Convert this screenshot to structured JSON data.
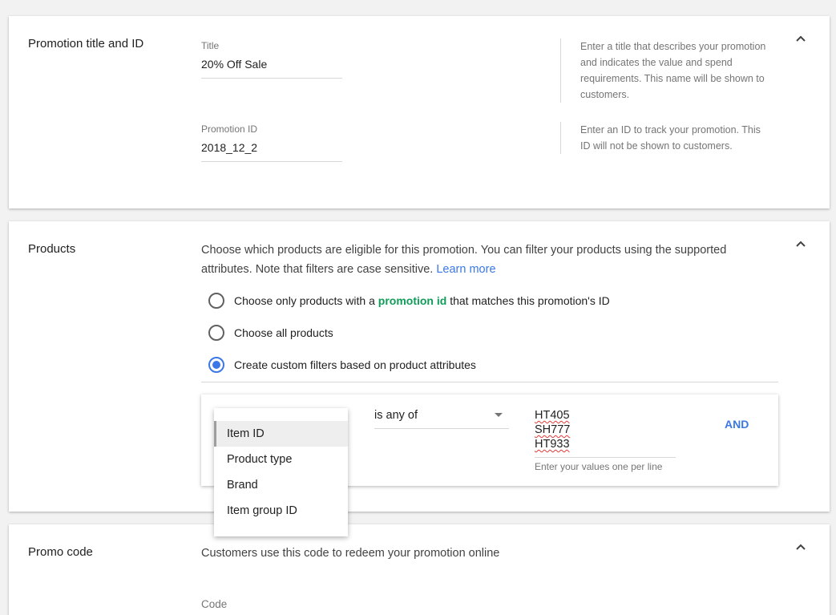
{
  "sections": {
    "title_id": {
      "label": "Promotion title and ID",
      "title_field": {
        "label": "Title",
        "value": "20% Off Sale"
      },
      "title_help": "Enter a title that describes your promotion and indicates the value and spend requirements. This name will be shown to customers.",
      "id_field": {
        "label": "Promotion ID",
        "value": "2018_12_2"
      },
      "id_help": "Enter an ID to track your promotion. This ID will not be shown to customers."
    },
    "products": {
      "label": "Products",
      "description": "Choose which products are eligible for this promotion. You can filter your products using the supported attributes. Note that filters are case sensitive.",
      "learn_more": "Learn more",
      "options": [
        {
          "prefix": "Choose only products with a ",
          "highlight": "promotion id",
          "suffix": " that matches this promotion's ID",
          "selected": false
        },
        {
          "label": "Choose all products",
          "selected": false
        },
        {
          "label": "Create custom filters based on product attributes",
          "selected": true
        }
      ],
      "filter": {
        "condition": "is any of",
        "values": [
          "HT405",
          "SH777",
          "HT933"
        ],
        "values_hint": "Enter your values one per line",
        "and_label": "AND",
        "attribute_menu": [
          "Item ID",
          "Product type",
          "Brand",
          "Item group ID"
        ],
        "selected_attribute": "Item ID"
      }
    },
    "promo_code": {
      "label": "Promo code",
      "description": "Customers use this code to redeem your promotion online",
      "code_label": "Code"
    }
  },
  "colors": {
    "accent": "#3b78e7",
    "highlight_green": "#0f9d58",
    "spellcheck_red": "#e53935"
  },
  "icons": {
    "collapse": "chevron-up-icon",
    "dropdown": "caret-down-icon"
  }
}
